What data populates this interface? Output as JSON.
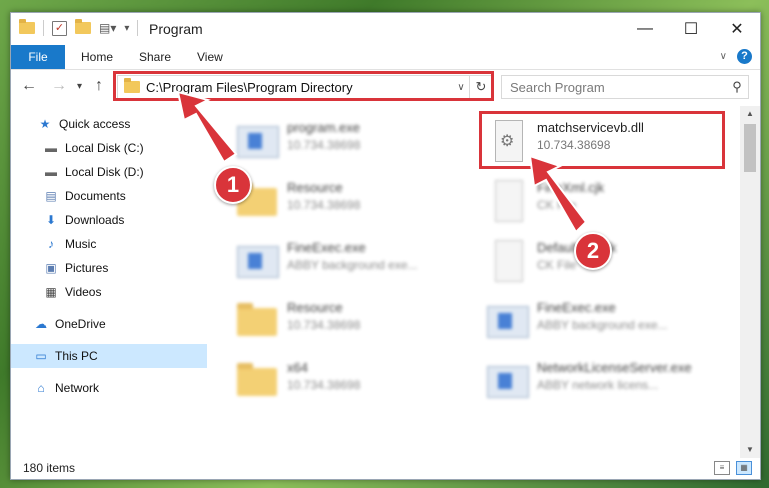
{
  "window": {
    "title": "Program",
    "controls": {
      "minimize": "—",
      "maximize": "☐",
      "close": "✕"
    }
  },
  "ribbon": {
    "tabs": [
      "File",
      "Home",
      "Share",
      "View"
    ]
  },
  "navigation": {
    "address": "C:\\Program Files\\Program Directory",
    "search_placeholder": "Search Program"
  },
  "sidebar": {
    "items": [
      {
        "label": "Quick access",
        "icon": "star-icon"
      },
      {
        "label": "Local Disk (C:)",
        "icon": "drive-icon",
        "pinned": true
      },
      {
        "label": "Local Disk (D:)",
        "icon": "drive-icon",
        "pinned": true
      },
      {
        "label": "Documents",
        "icon": "documents-icon",
        "pinned": true
      },
      {
        "label": "Downloads",
        "icon": "download-icon",
        "pinned": true
      },
      {
        "label": "Music",
        "icon": "music-icon",
        "pinned": true
      },
      {
        "label": "Pictures",
        "icon": "pictures-icon",
        "pinned": true
      },
      {
        "label": "Videos",
        "icon": "videos-icon",
        "pinned": true
      },
      {
        "label": "OneDrive",
        "icon": "cloud-icon"
      },
      {
        "label": "This PC",
        "icon": "computer-icon",
        "selected": true
      },
      {
        "label": "Network",
        "icon": "network-icon"
      }
    ]
  },
  "files": [
    {
      "name": "program.exe",
      "sub": "10.734.38698",
      "kind": "exe"
    },
    {
      "name": "matchservicevb.dll",
      "sub": "10.734.38698",
      "kind": "dll",
      "highlighted": true
    },
    {
      "name": "Resource",
      "sub": "10.734.38698",
      "kind": "folder"
    },
    {
      "name": "FineXml.cjk",
      "sub": "CK File",
      "kind": "doc"
    },
    {
      "name": "FineExec.exe",
      "sub": "ABBY background exe...",
      "kind": "app"
    },
    {
      "name": "DefaultCjk.cjk",
      "sub": "CK File",
      "kind": "doc"
    },
    {
      "name": "Resource",
      "sub": "10.734.38698",
      "kind": "folder"
    },
    {
      "name": "FineExec.exe",
      "sub": "ABBY background exe...",
      "kind": "app"
    },
    {
      "name": "x64",
      "sub": "10.734.38698",
      "kind": "folder"
    },
    {
      "name": "NetworkLicenseServer.exe",
      "sub": "ABBY network licens...",
      "kind": "app"
    }
  ],
  "status": {
    "items_count": "180 items"
  },
  "annotations": {
    "step1": "1",
    "step2": "2",
    "color": "#d9343a"
  }
}
